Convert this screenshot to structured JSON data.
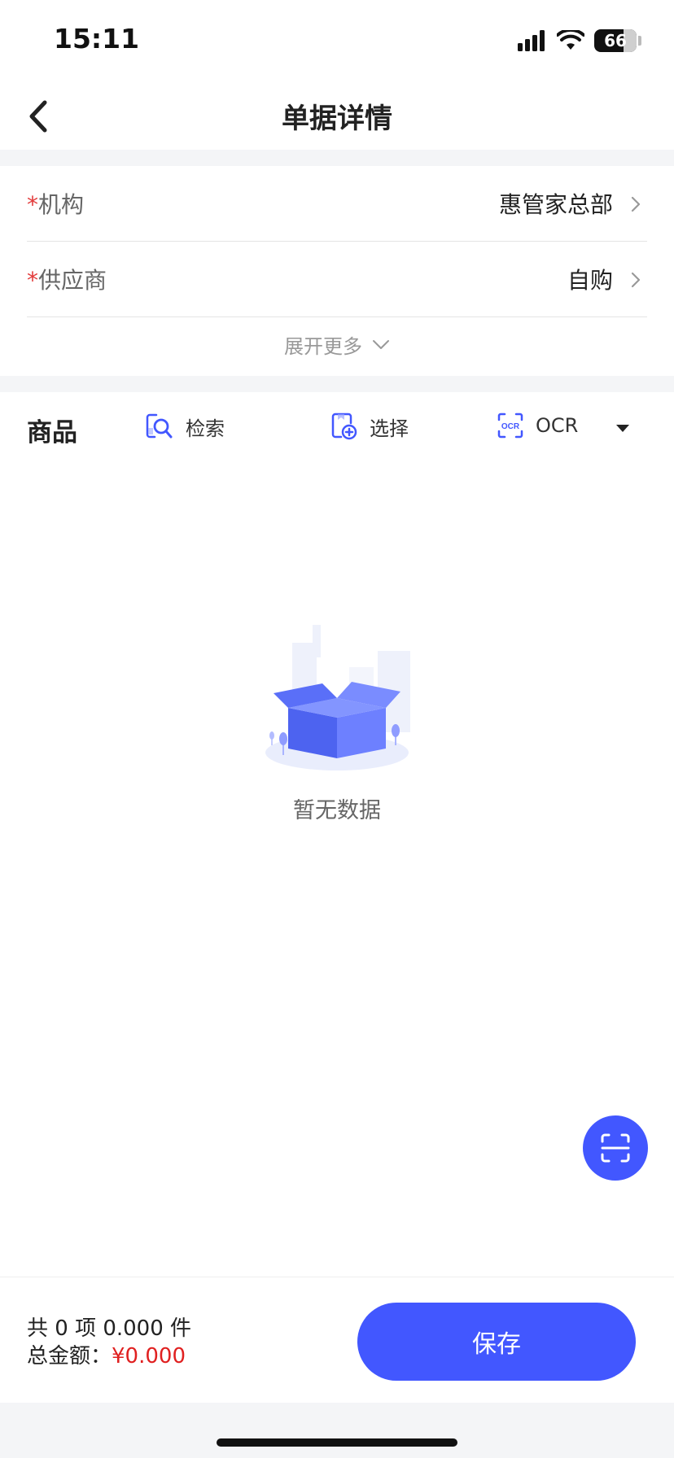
{
  "status_bar": {
    "time": "15:11",
    "battery": "66"
  },
  "nav": {
    "title": "单据详情"
  },
  "form": {
    "required_mark": "*",
    "rows": [
      {
        "label": "机构",
        "value": "惠管家总部"
      },
      {
        "label": "供应商",
        "value": "自购"
      }
    ],
    "expand_label": "展开更多"
  },
  "goods": {
    "title": "商品",
    "actions": {
      "search": "检索",
      "select": "选择",
      "ocr": "OCR"
    }
  },
  "empty": {
    "text": "暂无数据"
  },
  "summary": {
    "line1": "共 0 项 0.000 件",
    "amount_label": "总金额：",
    "amount_value": "¥0.000"
  },
  "save_label": "保存",
  "colors": {
    "accent": "#4257ff",
    "required": "#e23b3b",
    "amount": "#e02020"
  },
  "icons": {
    "back": "chevron-left-icon",
    "row_chevron": "chevron-right-icon",
    "expand": "chevron-down-icon",
    "search": "search-doc-icon",
    "select": "add-doc-icon",
    "ocr": "ocr-scan-icon",
    "ocr_dropdown": "caret-down-icon",
    "fab": "scan-icon"
  }
}
